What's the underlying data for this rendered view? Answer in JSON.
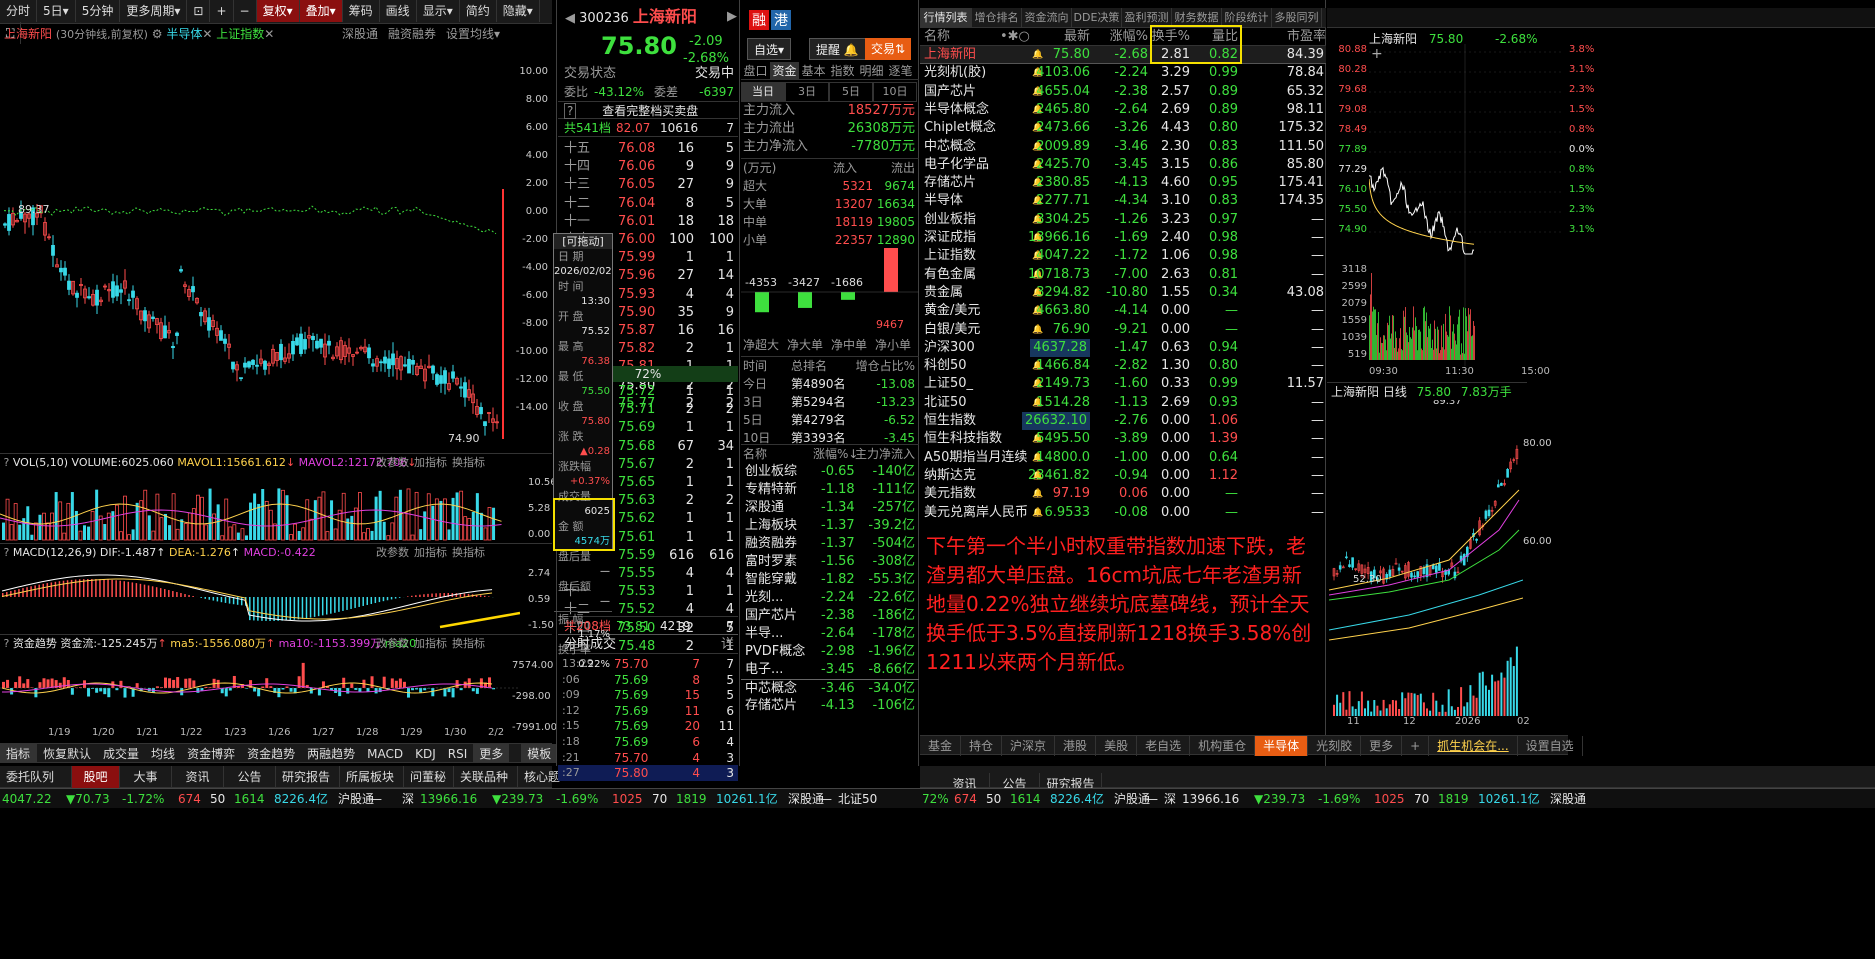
{
  "toolbar": {
    "items": [
      "分时",
      "5日",
      "5分钟",
      "更多周期",
      "复权",
      "叠加",
      "筹码",
      "画线",
      "显示",
      "简约",
      "隐藏"
    ]
  },
  "kline": {
    "title": "上海新阳",
    "subtitle": "(30分钟线,前复权)",
    "overlay1": "半导体",
    "overlay2": "上证指数",
    "links": [
      "深股通",
      "融资融券",
      "设置均线"
    ],
    "y_labels": [
      "10.00",
      "8.00",
      "6.00",
      "4.00",
      "2.00",
      "0.00",
      "-2.00",
      "-4.00",
      "-6.00",
      "-8.00",
      "-10.00",
      "-12.00",
      "-14.00"
    ],
    "high_label": "89.37",
    "low_label": "74.90",
    "vol": {
      "title": "VOL(5,10)",
      "v": "VOLUME:6025.060",
      "ma1": "MAVOL1:15661.612",
      "ma2": "MAVOL2:12172.706",
      "links": [
        "改参数",
        "加指标",
        "换指标"
      ],
      "y": [
        "10.56",
        "5.28",
        "0.00"
      ]
    },
    "macd": {
      "title": "MACD(12,26,9)",
      "dif": "DIF:-1.487",
      "dea": "DEA:-1.276",
      "macd": "MACD:-0.422",
      "y": [
        "2.74",
        "0.59",
        "-1.50"
      ]
    },
    "fund": {
      "title": "资金趋势",
      "flow": "资金流:-125.245万",
      "ma5": "ma5:-1556.080万",
      "ma10": "ma10:-1153.399万",
      "ma20": "ma20",
      "y": [
        "7574.00",
        "-298.00",
        "-7991.00"
      ]
    },
    "dates": [
      "1/19",
      "1/20",
      "1/21",
      "1/22",
      "1/23",
      "1/26",
      "1/27",
      "1/28",
      "1/29",
      "1/30",
      "2/2"
    ],
    "bottom_tabs": [
      "指标",
      "恢复默认",
      "成交量",
      "均线",
      "资金博弈",
      "资金趋势",
      "两融趋势",
      "MACD",
      "KDJ",
      "RSI",
      "更多",
      "模板"
    ],
    "lower_tabs": [
      "委托队列",
      "股吧",
      "大事",
      "资讯",
      "公告",
      "研究报告",
      "所属板块",
      "问董秘",
      "关联品种",
      "核心题"
    ]
  },
  "quote": {
    "code": "300236",
    "name": "上海新阳",
    "price": "75.80",
    "change": "-2.09",
    "pct": "-2.68%",
    "tags": [
      "融",
      "港"
    ],
    "btn_select": "自选",
    "btn_alert": "提醒",
    "btn_trade": "交易",
    "state_label": "交易状态",
    "state_val": "交易中",
    "wb_label": "委比",
    "wb": "-43.12%",
    "wc_label": "委差",
    "wc": "-6397",
    "full_queue": "查看完整档买卖盘",
    "sell_total": "共541档",
    "sell_total_p": "82.07",
    "sell_total_v": "10616",
    "sell_total_n": "7",
    "sells": [
      [
        "十五",
        "76.08",
        "16",
        "5"
      ],
      [
        "十四",
        "76.06",
        "9",
        "9"
      ],
      [
        "十三",
        "76.05",
        "27",
        "9"
      ],
      [
        "十二",
        "76.04",
        "8",
        "5"
      ],
      [
        "十一",
        "76.01",
        "18",
        "18"
      ],
      [
        "卖十",
        "76.00",
        "100",
        "100"
      ],
      [
        "",
        "75.99",
        "1",
        "1"
      ],
      [
        "",
        "75.96",
        "27",
        "14"
      ],
      [
        "",
        "75.93",
        "4",
        "4"
      ],
      [
        "",
        "75.90",
        "35",
        "9"
      ],
      [
        "",
        "75.87",
        "16",
        "16"
      ],
      [
        "",
        "75.82",
        "2",
        "1"
      ],
      [
        "",
        "75.81",
        "1",
        "1"
      ],
      [
        "",
        "75.80",
        "2",
        "2"
      ],
      [
        "",
        "75.77",
        "2",
        "2"
      ]
    ],
    "mid_pct": "72%",
    "buys": [
      [
        "",
        "75.72",
        "1",
        "1"
      ],
      [
        "",
        "75.71",
        "2",
        "2"
      ],
      [
        "",
        "75.69",
        "1",
        "1"
      ],
      [
        "",
        "75.68",
        "67",
        "34"
      ],
      [
        "",
        "75.67",
        "2",
        "1"
      ],
      [
        "",
        "75.65",
        "1",
        "1"
      ],
      [
        "",
        "75.63",
        "2",
        "2"
      ],
      [
        "",
        "75.62",
        "1",
        "1"
      ],
      [
        "",
        "75.61",
        "1",
        "1"
      ],
      [
        "",
        "75.59",
        "616",
        "616"
      ],
      [
        "",
        "75.55",
        "4",
        "4"
      ],
      [
        "十一",
        "75.53",
        "1",
        "1"
      ],
      [
        "十二",
        "75.52",
        "4",
        "4"
      ],
      [
        "十四",
        "75.50",
        "32",
        "5"
      ],
      [
        "十五",
        "75.48",
        "2",
        "1"
      ]
    ],
    "buy_total": "共208档",
    "buy_total_p": "73.81",
    "buy_total_v": "4219",
    "buy_total_n": "7",
    "popup": {
      "drag": "[可拖动]",
      "date_l": "日 期",
      "date": "2026/02/02",
      "time_l": "时 间",
      "time": "13:30",
      "open_l": "开 盘",
      "open": "75.52",
      "high_l": "最 高",
      "high": "76.38",
      "low_l": "最 低",
      "low": "75.50",
      "close_l": "收 盘",
      "close": "75.80",
      "chg_l": "涨 跌",
      "chg": "▲0.28",
      "chgp_l": "涨跌幅",
      "chgp": "+0.37%",
      "vol_l": "成交量",
      "vol": "6025",
      "amt_l": "金 额",
      "amt": "4574万",
      "after_l": "盘后量",
      "after": "—",
      "afteramt_l": "盘后额",
      "afteramt": "—",
      "amp_l": "振 幅",
      "amp": "1.17%",
      "turn_l": "换手率",
      "turn": "0.22%"
    },
    "ticks_title": "分时成交",
    "ticks_btn": "详",
    "ticks": [
      [
        "13:29",
        "75.70",
        "7",
        "7"
      ],
      [
        ":06",
        "75.69",
        "8",
        "5"
      ],
      [
        ":09",
        "75.69",
        "15",
        "5"
      ],
      [
        ":12",
        "75.69",
        "11",
        "6"
      ],
      [
        ":15",
        "75.69",
        "20",
        "11"
      ],
      [
        ":18",
        "75.69",
        "6",
        "4"
      ],
      [
        ":21",
        "75.70",
        "4",
        "3"
      ],
      [
        ":27",
        "75.80",
        "4",
        "3"
      ]
    ]
  },
  "fundflow": {
    "tabs": [
      "盘口",
      "资金",
      "基本",
      "指数",
      "明细",
      "逐笔"
    ],
    "periods": [
      "当日",
      "3日",
      "5日",
      "10日"
    ],
    "main_in_l": "主力流入",
    "main_in": "18527万元",
    "main_out_l": "主力流出",
    "main_out": "26308万元",
    "main_net_l": "主力净流入",
    "main_net": "-7780万元",
    "th": [
      "(万元)",
      "流入",
      "流出"
    ],
    "rows": [
      [
        "超大",
        "5321",
        "9674"
      ],
      [
        "大单",
        "13207",
        "16634"
      ],
      [
        "中单",
        "18119",
        "19805"
      ],
      [
        "小单",
        "22357",
        "12890"
      ]
    ],
    "net_vals": [
      "-4353",
      "-3427",
      "-1686",
      "9467"
    ],
    "net_labels": [
      "净超大",
      "净大单",
      "净中单",
      "净小单"
    ],
    "rank_h": [
      "时间",
      "总排名",
      "增仓占比%"
    ],
    "ranks": [
      [
        "今日",
        "第4890名",
        "-13.08"
      ],
      [
        "3日",
        "第5294名",
        "-13.23"
      ],
      [
        "5日",
        "第4279名",
        "-6.52"
      ],
      [
        "10日",
        "第3393名",
        "-3.45"
      ]
    ],
    "sector_h": [
      "名称",
      "涨幅%↓",
      "主力净流入"
    ],
    "sectors": [
      [
        "创业板综",
        "-0.65",
        "-140亿"
      ],
      [
        "专精特新",
        "-1.18",
        "-111亿"
      ],
      [
        "深股通",
        "-1.34",
        "-257亿"
      ],
      [
        "上海板块",
        "-1.37",
        "-39.2亿"
      ],
      [
        "融资融券",
        "-1.37",
        "-504亿"
      ],
      [
        "富时罗素",
        "-1.56",
        "-308亿"
      ],
      [
        "智能穿戴",
        "-1.82",
        "-55.3亿"
      ],
      [
        "光刻...",
        "-2.24",
        "-22.6亿"
      ],
      [
        "国产芯片",
        "-2.38",
        "-186亿"
      ],
      [
        "半导...",
        "-2.64",
        "-178亿"
      ],
      [
        "PVDF概念",
        "-2.98",
        "-1.96亿"
      ],
      [
        "电子...",
        "-3.45",
        "-8.66亿"
      ],
      [
        "中芯概念",
        "-3.46",
        "-34.0亿"
      ],
      [
        "存储芯片",
        "-4.13",
        "-106亿"
      ]
    ]
  },
  "market": {
    "tabs": [
      "行情列表",
      "增仓排名",
      "资金流向",
      "DDE决策",
      "盈利预测",
      "财务数据",
      "阶段统计",
      "多股同列"
    ],
    "th": [
      "名称",
      "最新",
      "涨幅%",
      "换手%",
      "量比",
      "市盈率"
    ],
    "rows": [
      [
        "上海新阳",
        "75.80",
        "-2.68",
        "2.81",
        "0.82",
        "84.39"
      ],
      [
        "光刻机(胶)",
        "4103.06",
        "-2.24",
        "3.29",
        "0.99",
        "78.84"
      ],
      [
        "国产芯片",
        "4655.04",
        "-2.38",
        "2.57",
        "0.89",
        "65.32"
      ],
      [
        "半导体概念",
        "2465.80",
        "-2.64",
        "2.69",
        "0.89",
        "98.11"
      ],
      [
        "Chiplet概念",
        "2473.66",
        "-3.26",
        "4.43",
        "0.80",
        "175.32"
      ],
      [
        "中芯概念",
        "2009.89",
        "-3.46",
        "2.30",
        "0.83",
        "111.50"
      ],
      [
        "电子化学品",
        "2425.70",
        "-3.45",
        "3.15",
        "0.86",
        "85.80"
      ],
      [
        "存储芯片",
        "2380.85",
        "-4.13",
        "4.60",
        "0.95",
        "175.41"
      ],
      [
        "半导体",
        "2277.71",
        "-4.34",
        "3.10",
        "0.83",
        "174.35"
      ],
      [
        "创业板指",
        "3304.25",
        "-1.26",
        "3.23",
        "0.97",
        "—"
      ],
      [
        "深证成指",
        "13966.16",
        "-1.69",
        "2.40",
        "0.98",
        "—"
      ],
      [
        "上证指数",
        "4047.22",
        "-1.72",
        "1.06",
        "0.98",
        "—"
      ],
      [
        "有色金属",
        "10718.73",
        "-7.00",
        "2.63",
        "0.81",
        "—"
      ],
      [
        "贵金属",
        "3294.82",
        "-10.80",
        "1.55",
        "0.34",
        "43.08"
      ],
      [
        "黄金/美元",
        "4663.80",
        "-4.14",
        "0.00",
        "—",
        "—"
      ],
      [
        "白银/美元",
        "76.90",
        "-9.21",
        "0.00",
        "—",
        "—"
      ],
      [
        "沪深300",
        "4637.28",
        "-1.47",
        "0.63",
        "0.94",
        "—"
      ],
      [
        "科创50",
        "1466.84",
        "-2.82",
        "1.30",
        "0.80",
        "—"
      ],
      [
        "上证50_",
        "2149.73",
        "-1.60",
        "0.33",
        "0.99",
        "11.57"
      ],
      [
        "北证50",
        "1514.28",
        "-1.13",
        "2.69",
        "0.93",
        "—"
      ],
      [
        "恒生指数",
        "26632.10",
        "-2.76",
        "0.00",
        "1.06",
        "—"
      ],
      [
        "恒生科技指数",
        "5495.50",
        "-3.89",
        "0.00",
        "1.39",
        "—"
      ],
      [
        "A50期指当月连续",
        "14800.0",
        "-1.00",
        "0.00",
        "0.64",
        "—"
      ],
      [
        "纳斯达克",
        "23461.82",
        "-0.94",
        "0.00",
        "1.12",
        "—"
      ],
      [
        "美元指数",
        "97.19",
        "0.06",
        "0.00",
        "—",
        "—"
      ],
      [
        "美元兑离岸人民币",
        "6.9533",
        "-0.08",
        "0.00",
        "—",
        "—"
      ]
    ],
    "note": "下午第一个半小时权重带指数加速下跌，老渣男都大单压盘。16cm坑底七年老渣男新地量0.22%独立继续坑底墓碑线，预计全天换手低于3.5%直接刷新1218换手3.58%创1211以来两个月新低。",
    "bottom_tabs": [
      "基金",
      "持仓",
      "沪深京",
      "港股",
      "美股",
      "老自选",
      "机构重仓",
      "半导体",
      "光刻胶",
      "更多",
      "+",
      "抓生机会在...",
      "设置自选"
    ],
    "lower_tabs": [
      "资讯",
      "公告",
      "研究报告"
    ]
  },
  "mini": {
    "name": "上海新阳",
    "price": "75.80",
    "pct": "-2.68%",
    "y_left": [
      "80.88",
      "80.28",
      "79.68",
      "79.08",
      "78.49",
      "77.89",
      "77.29",
      "76.10",
      "75.50",
      "74.90"
    ],
    "y_right": [
      "3.8%",
      "3.1%",
      "2.3%",
      "1.5%",
      "0.8%",
      "0.0%",
      "0.8%",
      "1.5%",
      "2.3%",
      "3.1%"
    ],
    "vol_y": [
      "3118",
      "2599",
      "2079",
      "1559",
      "1039",
      "519"
    ],
    "times": [
      "09:30",
      "11:30",
      "15:00"
    ],
    "daily_name": "上海新阳 日线",
    "daily_price": "75.80",
    "daily_vol": "7.83万手",
    "daily_high": "89.37",
    "daily_low": "52.30",
    "daily_y": "80.00",
    "daily_y2": "60.00",
    "daily_x": [
      "11",
      "12",
      "2026",
      "02"
    ]
  },
  "status": {
    "left": [
      "4047.22",
      "▼70.73",
      "-1.72%",
      "674",
      "50",
      "1614",
      "8226.4亿",
      "沪股通",
      "—"
    ],
    "mid": [
      "深",
      "13966.16",
      "▼239.73",
      "-1.69%",
      "1025",
      "70",
      "1819",
      "10261.1亿",
      "深股通",
      "—",
      "北证50"
    ],
    "right": [
      "72%",
      "674",
      "50",
      "1614",
      "8226.4亿",
      "沪股通",
      "—",
      "深",
      "13966.16",
      "▼239.73",
      "-1.69%",
      "1025",
      "70",
      "1819",
      "10261.1亿",
      "深股通"
    ]
  },
  "colors": {
    "up": "#ff4d4d",
    "down": "#3ee03e",
    "accent": "#ffd24d",
    "cyan": "#38d9e8"
  }
}
